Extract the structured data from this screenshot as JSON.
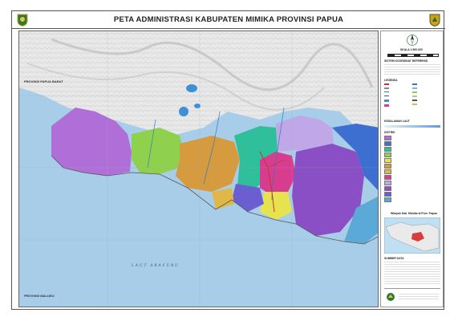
{
  "header": {
    "title": "PETA ADMINISTRASI KABUPATEN MIMIKA PROVINSI PAPUA"
  },
  "map": {
    "labels": {
      "province_west": "PROVINSI PAPUA BARAT",
      "province_south": "PROVINSI MALUKU",
      "sea": "LAUT ARAFURU"
    },
    "colors": {
      "sea": "#a8cde8",
      "highland": "#e9e9e9",
      "district_1": "#b06fd8",
      "district_2": "#8a4fc4",
      "district_3": "#8fd14f",
      "district_4": "#d69a3f",
      "district_5": "#e0b84a",
      "district_6": "#3c6fd0",
      "district_7": "#2fbf9a",
      "district_8": "#c0a8e8",
      "district_9": "#d83c8f",
      "district_10": "#5aa9d6",
      "district_11": "#e6e34f",
      "district_12": "#6b5ed1"
    }
  },
  "panel": {
    "scale_label": "SKALA 1:500.000",
    "coord_heading": "SISTEM KOORDINAT REFERENSI",
    "legend_heading": "LEGENDA",
    "depth_heading": "KEDALAMAN LAUT",
    "district_heading": "DISTRIK",
    "inset_heading": "Wilayah Kab. Mimika di Prov. Papua",
    "sources_heading": "SUMBER DATA"
  }
}
